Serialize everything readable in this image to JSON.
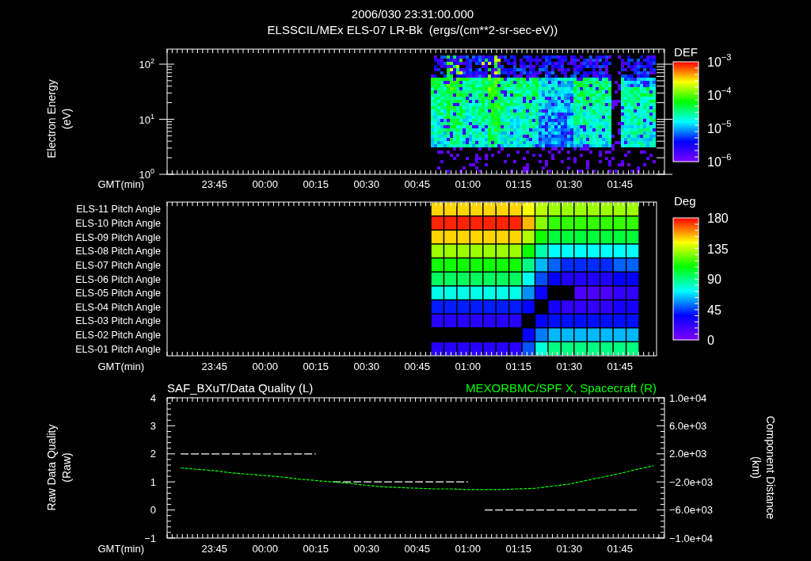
{
  "header": {
    "title": "2006/030 23:31:00.000",
    "subtitle": "ELSSCIL/MEx ELS-07 LR-Bk  (ergs/(cm**2-sr-sec-eV))"
  },
  "spectrogram": {
    "ylabel": "Electron Energy",
    "yunit": "(eV)",
    "yticks": [
      {
        "base": "10",
        "exponent": "2"
      },
      {
        "base": "10",
        "exponent": "1"
      },
      {
        "base": "10",
        "exponent": "0"
      }
    ],
    "xaxis_label": "GMT(min)",
    "xticks": [
      "23:45",
      "00:00",
      "00:15",
      "00:30",
      "00:45",
      "01:00",
      "01:15",
      "01:30",
      "01:45"
    ],
    "colorbar": {
      "title": "DEF",
      "ticks": [
        {
          "base": "10",
          "exponent": "−3"
        },
        {
          "base": "10",
          "exponent": "−4"
        },
        {
          "base": "10",
          "exponent": "−5"
        },
        {
          "base": "10",
          "exponent": "−6"
        }
      ]
    }
  },
  "pitch_angle": {
    "rows": [
      "ELS-11 Pitch Angle",
      "ELS-10 Pitch Angle",
      "ELS-09 Pitch Angle",
      "ELS-08 Pitch Angle",
      "ELS-07 Pitch Angle",
      "ELS-06 Pitch Angle",
      "ELS-05 Pitch Angle",
      "ELS-04 Pitch Angle",
      "ELS-03 Pitch Angle",
      "ELS-02 Pitch Angle",
      "ELS-01 Pitch Angle"
    ],
    "xaxis_label": "GMT(min)",
    "xticks": [
      "23:45",
      "00:00",
      "00:15",
      "00:30",
      "00:45",
      "01:00",
      "01:15",
      "01:30",
      "01:45"
    ],
    "colorbar": {
      "title": "Deg",
      "ticks": [
        "180",
        "135",
        "90",
        "45",
        "0"
      ]
    }
  },
  "timeseries": {
    "ylabel": "Raw Data Quality",
    "yunit": "(Raw)",
    "y2label": "Component Distance",
    "y2unit": "(km)",
    "xaxis_label": "GMT(min)",
    "chart_data": {
      "type": "line",
      "categories": [
        null,
        null,
        "23:45",
        null,
        null,
        "00:00",
        null,
        null,
        "00:15",
        null,
        null,
        "00:30",
        null,
        null,
        "00:45",
        null,
        null,
        "01:00",
        null,
        null,
        "01:15",
        null,
        null,
        "01:30",
        null,
        null,
        "01:45",
        null,
        null
      ],
      "ylim": [
        -1,
        4
      ],
      "yticks": [
        -1,
        0,
        1,
        2,
        3,
        4
      ],
      "y2lim": [
        -10000,
        10000
      ],
      "y2ticks": [
        {
          "value": 10000,
          "label": "1.0e+04"
        },
        {
          "value": 6000,
          "label": "6.0e+03"
        },
        {
          "value": 2000,
          "label": "2.0e+03"
        },
        {
          "value": -2000,
          "label": "−2.0e+03"
        },
        {
          "value": -6000,
          "label": "−6.0e+03"
        },
        {
          "value": -10000,
          "label": "−1.0e+04"
        }
      ],
      "series": [
        {
          "name": "SAF_BXuT/Data Quality (L)",
          "color": "#ffffff",
          "line_style": "dashed",
          "values": [
            2,
            2,
            2,
            2,
            2,
            2,
            2,
            2,
            2,
            1,
            1,
            1,
            1,
            1,
            1,
            1,
            1,
            1,
            0,
            0,
            0,
            0,
            0,
            0,
            0,
            0,
            0,
            0,
            null
          ]
        },
        {
          "name": "MEXORBMC/SPF X, Spacecraft (R)",
          "color": "#00ff00",
          "axis": "y2",
          "line_style": "dotted",
          "values": [
            0,
            -200,
            -400,
            -700,
            -900,
            -1100,
            -1300,
            -1600,
            -1800,
            -2000,
            -2200,
            -2500,
            -2700,
            -2800,
            -2900,
            -3000,
            -3000,
            -3100,
            -3100,
            -3100,
            -3000,
            -2900,
            -2600,
            -2300,
            -1800,
            -1300,
            -800,
            -200,
            300
          ]
        }
      ]
    }
  }
}
